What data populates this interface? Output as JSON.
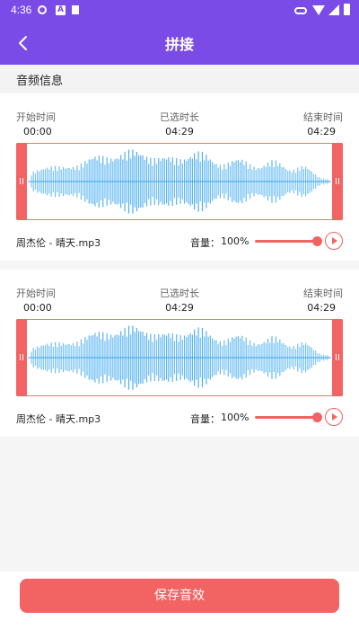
{
  "status_bar": {
    "time": "4:36",
    "icons": [
      "settings-icon",
      "font-a-icon",
      "sim-icon",
      "vpn-key-icon",
      "wifi-icon",
      "signal-icon",
      "battery-icon"
    ]
  },
  "header": {
    "title": "拼接",
    "back_icon": "chevron-left-icon"
  },
  "section": {
    "label": "音频信息"
  },
  "clips": [
    {
      "start_label": "开始时间",
      "start_value": "00:00",
      "selected_label": "已选时长",
      "selected_value": "04:29",
      "end_label": "结束时间",
      "end_value": "04:29",
      "file_name": "周杰伦 - 晴天.mp3",
      "volume_label": "音量：",
      "volume_value": "100%",
      "volume_level": 1.0
    },
    {
      "start_label": "开始时间",
      "start_value": "00:00",
      "selected_label": "已选时长",
      "selected_value": "04:29",
      "end_label": "结束时间",
      "end_value": "04:29",
      "file_name": "周杰伦 - 晴天.mp3",
      "volume_label": "音量：",
      "volume_value": "100%",
      "volume_level": 1.0
    }
  ],
  "footer": {
    "save_label": "保存音效"
  },
  "colors": {
    "primary": "#7a4be6",
    "accent": "#f26363",
    "wave": "#3aa6f0"
  }
}
